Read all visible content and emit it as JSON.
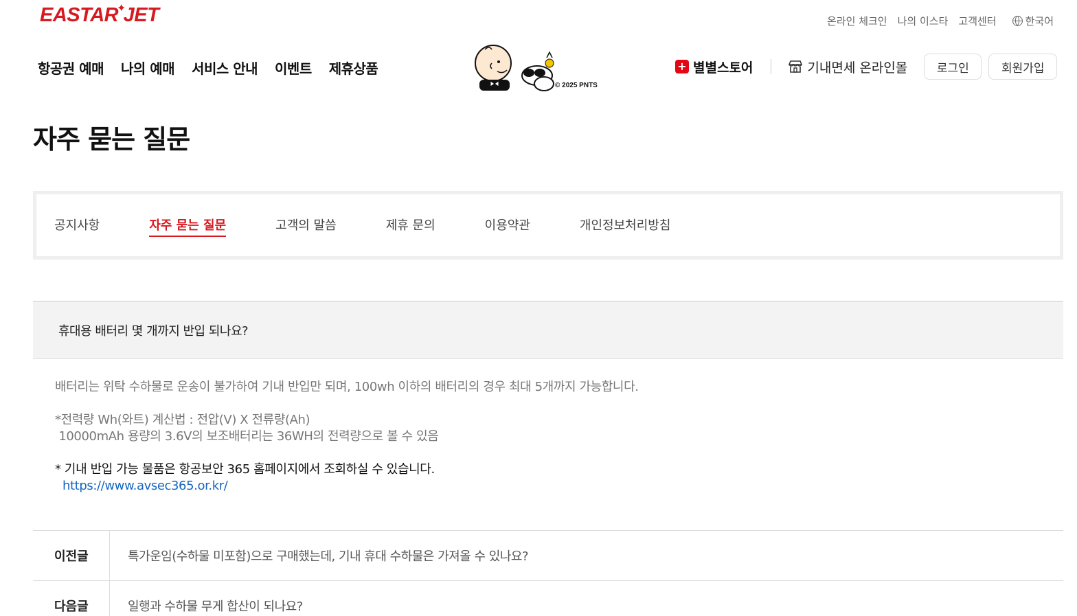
{
  "header": {
    "logo": "EASTAR JET",
    "util": [
      "온라인 체크인",
      "나의 이스타",
      "고객센터"
    ],
    "lang": "한국어",
    "gnb": [
      "항공권 예매",
      "나의 예매",
      "서비스 안내",
      "이벤트",
      "제휴상품"
    ],
    "peanuts_copy": "© 2025 PNTS",
    "store": "별별스토어",
    "dutyfree": "기내면세 온라인몰",
    "login": "로그인",
    "join": "회원가입"
  },
  "page_title": "자주 묻는 질문",
  "tabs": [
    "공지사항",
    "자주 묻는 질문",
    "고객의 말씀",
    "제휴 문의",
    "이용약관",
    "개인정보처리방침"
  ],
  "active_tab": "자주 묻는 질문",
  "question": "휴대용 배터리 몇 개까지 반입 되나요?",
  "answer": {
    "line1": "배터리는 위탁 수하물로 운송이 불가하여 기내 반입만 되며, 100wh 이하의 배터리의 경우 최대 5개까지 가능합니다.",
    "line2": "*전력량 Wh(와트) 계산법 : 전압(V) X 전류량(Ah)",
    "line3": " 10000mAh 용량의 3.6V의 보조배터리는 36WH의 전력량으로 볼 수 있음",
    "line4": "* 기내 반입 가능 물품은 항공보안 365 홈페이지에서 조회하실 수 있습니다.",
    "link": "https://www.avsec365.or.kr/"
  },
  "prev": {
    "label": "이전글",
    "title": "특가운임(수하물 미포함)으로 구매했는데, 기내 휴대 수하물은 가져올 수 있나요?"
  },
  "next": {
    "label": "다음글",
    "title": "일행과 수하물 무게 합산이 되나요?"
  }
}
